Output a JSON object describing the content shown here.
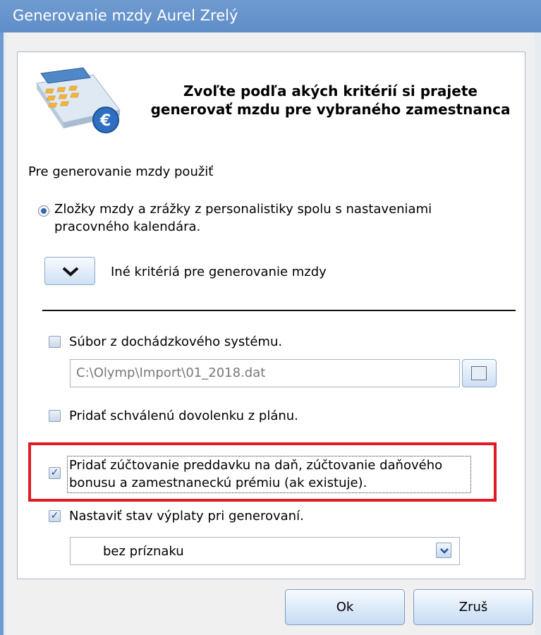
{
  "window": {
    "title": "Generovanie mzdy Aurel Zrelý"
  },
  "header": {
    "line1": "Zvoľte podľa akých kritérií si prajete",
    "line2": "generovať mzdu pre vybraného zamestnanca"
  },
  "section_label": "Pre generovanie mzdy použiť",
  "radio_option": {
    "line1": "Zložky mzdy a zrážky z personalistiky spolu s nastaveniami",
    "line2": "pracovného kalendára.",
    "selected": true
  },
  "expander_label": "Iné kritériá pre generovanie mzdy",
  "options": {
    "attendance": {
      "label": "Súbor z dochádzkového systému.",
      "checked": false
    },
    "attendance_path": "C:\\Olymp\\Import\\01_2018.dat",
    "vacation": {
      "label": "Pridať schválenú dovolenku z plánu.",
      "checked": false
    },
    "tax": {
      "line1": "Pridať zúčtovanie preddavku na daň, zúčtovanie daňového",
      "line2": "bonusu a zamestnaneckú prémiu (ak existuje).",
      "checked": true
    },
    "payout": {
      "label": "Nastaviť stav výplaty pri generovaní.",
      "checked": true
    },
    "payout_status": "bez príznaku"
  },
  "buttons": {
    "ok": "Ok",
    "cancel": "Zruš"
  },
  "colors": {
    "highlight": "#e01b24",
    "titlebar": "#6f9bd0"
  },
  "icons": {
    "header": "calculator-euro-icon",
    "browse": "browse-file-icon"
  }
}
